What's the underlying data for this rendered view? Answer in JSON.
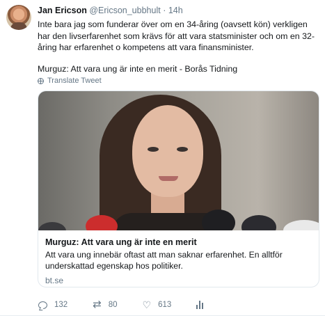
{
  "tweet": {
    "author_name": "Jan Ericson",
    "author_handle": "@Ericson_ubbhult",
    "separator": "·",
    "time": "14h",
    "text_p1": "Inte bara jag som funderar över om en 34-åring (oavsett kön) verkligen har den livserfarenhet som krävs för att vara statsminister och om en 32-åring har erfarenhet o kompetens att vara finansminister.",
    "text_p2": "Murguz: Att vara ung är inte en merit - Borås Tidning",
    "translate_label": "Translate Tweet"
  },
  "card": {
    "title": "Murguz: Att vara ung är inte en merit",
    "description": "Att vara ung innebär oftast att man saknar erfarenhet. En alltför underskattad egenskap hos politiker.",
    "domain": "bt.se"
  },
  "actions": {
    "reply_count": "132",
    "retweet_count": "80",
    "like_count": "613",
    "reply_icon": "reply-icon",
    "retweet_icon": "retweet-icon",
    "like_icon": "heart-icon",
    "stats_icon": "analytics-icon"
  },
  "colors": {
    "text": "#14171a",
    "secondary": "#657786",
    "border": "#e1e8ed"
  }
}
